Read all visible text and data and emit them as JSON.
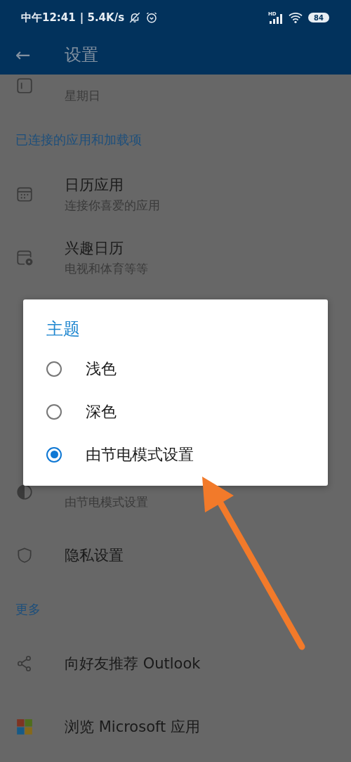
{
  "status_bar": {
    "time": "中午12:41",
    "speed": "| 5.4K/s",
    "network": "HD",
    "battery": "84"
  },
  "app_bar": {
    "back": "←",
    "title": "设置"
  },
  "rows": [
    {
      "kind": "item",
      "subtitle": "星期日"
    },
    {
      "kind": "section",
      "label": "已连接的应用和加载项"
    },
    {
      "kind": "item",
      "title": "日历应用",
      "subtitle": "连接你喜爱的应用"
    },
    {
      "kind": "item",
      "title": "兴趣日历",
      "subtitle": "电视和体育等等"
    },
    {
      "kind": "item"
    },
    {
      "kind": "section"
    },
    {
      "kind": "item"
    },
    {
      "kind": "item",
      "subtitle": "由节电模式设置"
    },
    {
      "kind": "item",
      "title": "隐私设置"
    },
    {
      "kind": "section",
      "label": "更多"
    },
    {
      "kind": "item",
      "title": "向好友推荐 Outlook"
    },
    {
      "kind": "item",
      "title": "浏览 Microsoft 应用"
    }
  ],
  "dialog": {
    "title": "主题",
    "options": [
      {
        "label": "浅色",
        "selected": false
      },
      {
        "label": "深色",
        "selected": false
      },
      {
        "label": "由节电模式设置",
        "selected": true
      }
    ]
  }
}
